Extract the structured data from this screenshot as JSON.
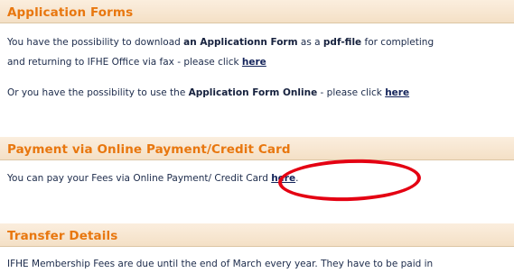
{
  "application_forms": {
    "title": "Application Forms",
    "p1_a": "You have the possibility to download ",
    "p1_b": "an Applicationn Form",
    "p1_c": " as a ",
    "p1_d": "pdf-file",
    "p1_e": " for completing",
    "p1_f": "and returning to IFHE Office via fax - please click ",
    "p1_link": "here",
    "p2_a": "Or you have the possibility to use the ",
    "p2_b": "Application Form Online",
    "p2_c": " - please click ",
    "p2_link": "here"
  },
  "payment": {
    "title": "Payment via Online Payment/Credit Card",
    "p1_a": "You can pay your Fees via Online Payment/ Credit Card ",
    "p1_link": "here",
    "p1_end": "."
  },
  "transfer": {
    "title": "Transfer Details",
    "p1": "IFHE Membership Fees are due until the end of March every year. They have to be paid in"
  },
  "colors": {
    "heading": "#e8770f",
    "header_band": "#f4e0c6",
    "text": "#1b2a4a",
    "annotation_ellipse": "#e40012"
  }
}
